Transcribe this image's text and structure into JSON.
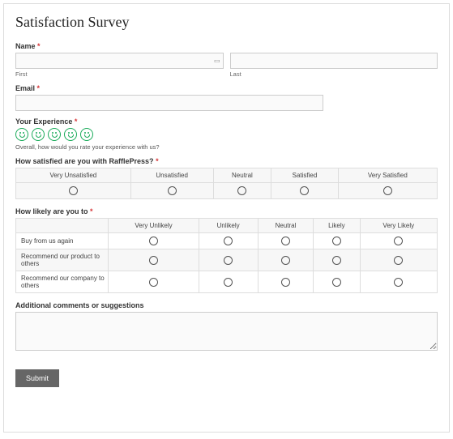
{
  "title": "Satisfaction Survey",
  "name": {
    "label": "Name",
    "first_sub": "First",
    "last_sub": "Last"
  },
  "email": {
    "label": "Email"
  },
  "experience": {
    "label": "Your Experience",
    "help": "Overall, how would you rate your experience with us?"
  },
  "sat": {
    "label": "How satisfied are you with RafflePress?",
    "cols": [
      "Very Unsatisfied",
      "Unsatisfied",
      "Neutral",
      "Satisfied",
      "Very Satisfied"
    ]
  },
  "likely": {
    "label": "How likely are you to",
    "cols": [
      "Very Unlikely",
      "Unlikely",
      "Neutral",
      "Likely",
      "Very Likely"
    ],
    "rows": [
      "Buy from us again",
      "Recommend our product to others",
      "Recommend our company to others"
    ]
  },
  "comments": {
    "label": "Additional comments or suggestions"
  },
  "submit": "Submit",
  "req_mark": "*"
}
